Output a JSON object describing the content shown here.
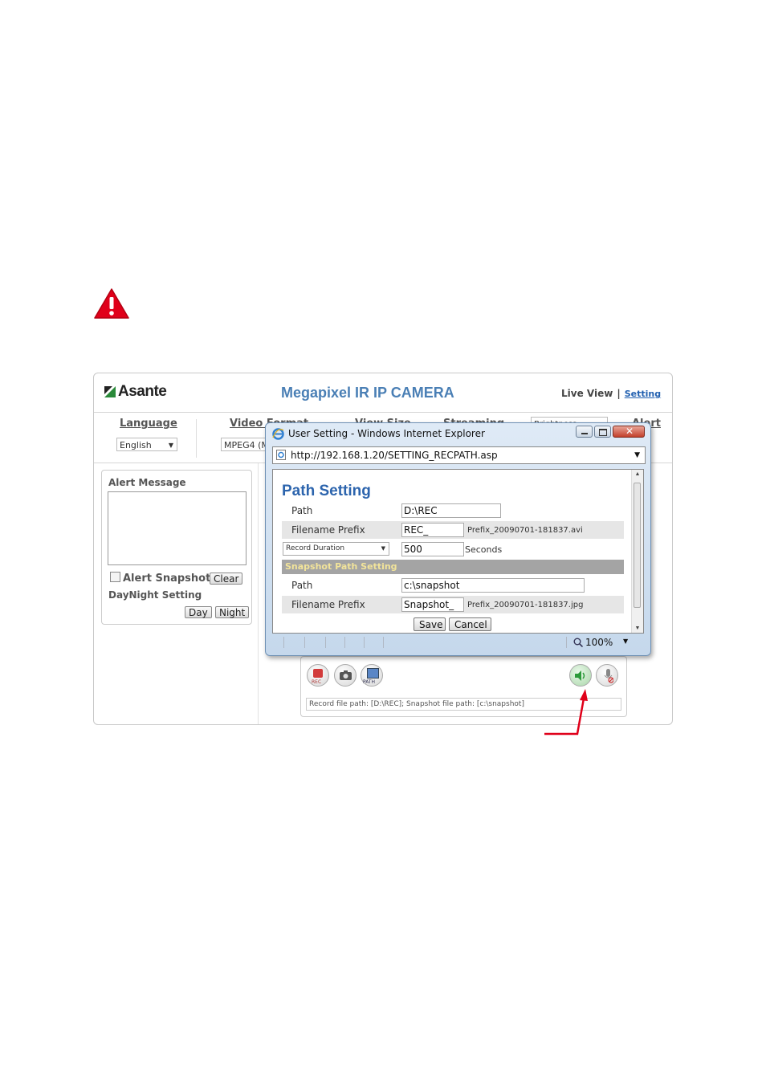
{
  "camera_page": {
    "logo": "Asante",
    "title": "Megapixel IR IP CAMERA",
    "nav": {
      "live_view": "Live View",
      "separator": "|",
      "setting": "Setting"
    },
    "toolbar": {
      "labels": [
        "Language",
        "Video Format",
        "View Size",
        "Streaming",
        "Alert"
      ],
      "language_value": "English",
      "video_format_value": "MPEG4 (M",
      "brightness_value": "Brightness"
    },
    "left_panel": {
      "alert_message_label": "Alert Message",
      "alert_snapshot_label": "Alert Snapshot",
      "clear_button": "Clear",
      "daynight_label": "DayNight Setting",
      "day_button": "Day",
      "night_button": "Night"
    },
    "controls": {
      "rec_label": "REC",
      "path_label": "PATH",
      "status_text": "Record file path: [D:\\REC]; Snapshot file path: [c:\\snapshot]"
    }
  },
  "popup": {
    "window_title": "User Setting - Windows Internet Explorer",
    "address": "http://192.168.1.20/SETTING_RECPATH.asp",
    "heading": "Path Setting",
    "record": {
      "path_label": "Path",
      "path_value": "D:\\REC",
      "prefix_label": "Filename Prefix",
      "prefix_value": "REC_",
      "prefix_hint": "Prefix_20090701-181837.avi",
      "duration_select": "Record Duration",
      "duration_value": "500",
      "duration_unit": "Seconds"
    },
    "snapshot": {
      "section_title": "Snapshot Path Setting",
      "path_label": "Path",
      "path_value": "c:\\snapshot",
      "prefix_label": "Filename Prefix",
      "prefix_value": "Snapshot_",
      "prefix_hint": "Prefix_20090701-181837.jpg"
    },
    "save_button": "Save",
    "cancel_button": "Cancel",
    "zoom": "100%"
  },
  "colors": {
    "accent_blue": "#2c64ad",
    "section_header": "#a4a4a4",
    "arrow_red": "#e0001a",
    "warning_red": "#e0001a"
  }
}
